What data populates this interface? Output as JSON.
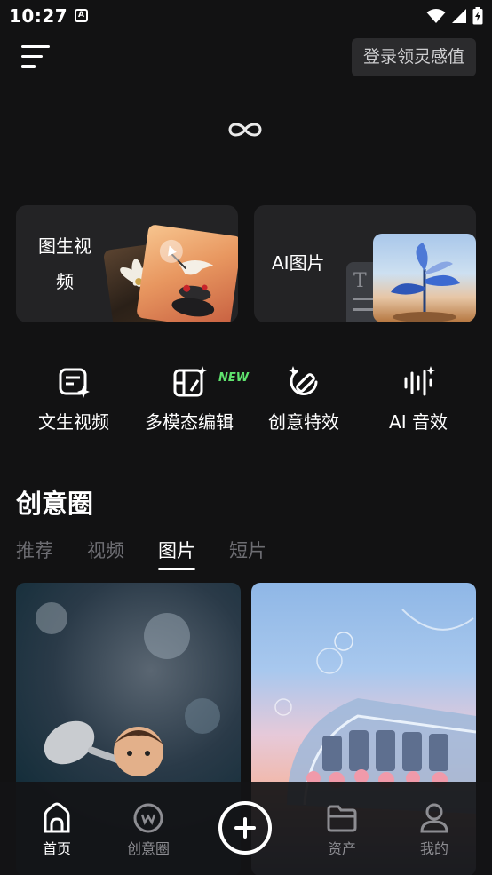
{
  "status_bar": {
    "time": "10:27",
    "notification_icon": "a-badge-icon",
    "icons": [
      "wifi-icon",
      "cellular-signal-icon",
      "battery-charging-icon"
    ]
  },
  "header": {
    "menu_icon": "menu-icon",
    "login_label": "登录领灵感值",
    "logo_icon": "infinity-logo-icon"
  },
  "feature_cards": [
    {
      "label": "图生视频"
    },
    {
      "label": "AI图片"
    }
  ],
  "tools": [
    {
      "label": "文生视频",
      "icon": "text-to-video-icon"
    },
    {
      "label": "多模态编辑",
      "icon": "multimodal-edit-icon",
      "badge": "NEW"
    },
    {
      "label": "创意特效",
      "icon": "creative-effects-icon"
    },
    {
      "label": "AI 音效",
      "icon": "audio-wave-icon"
    }
  ],
  "creative_circle": {
    "title": "创意圈",
    "tabs": [
      {
        "label": "推荐",
        "active": false
      },
      {
        "label": "视频",
        "active": false
      },
      {
        "label": "图片",
        "active": true
      },
      {
        "label": "短片",
        "active": false
      }
    ]
  },
  "bottom_nav": {
    "items": [
      {
        "label": "首页",
        "icon": "home-icon",
        "active": true
      },
      {
        "label": "创意圈",
        "icon": "creative-circle-icon",
        "active": false
      },
      {
        "label": "资产",
        "icon": "folder-icon",
        "active": false
      },
      {
        "label": "我的",
        "icon": "profile-icon",
        "active": false
      }
    ],
    "create_icon": "plus-circle-icon"
  },
  "colors": {
    "background": "#121213",
    "card": "#232325",
    "login_button": "#2b2b2d",
    "new_badge": "#5fe36e",
    "inactive_text": "#6d6d72"
  }
}
